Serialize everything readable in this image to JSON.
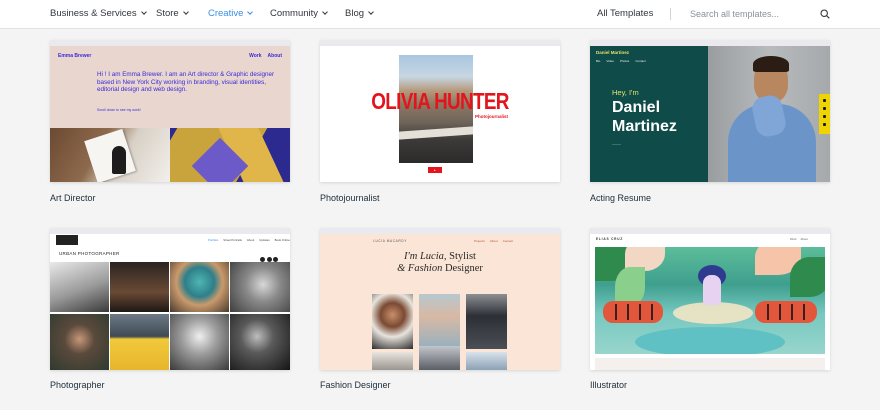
{
  "nav": {
    "items": [
      {
        "label": "Business & Services",
        "active": false
      },
      {
        "label": "Store",
        "active": false
      },
      {
        "label": "Creative",
        "active": true
      },
      {
        "label": "Community",
        "active": false
      },
      {
        "label": "Blog",
        "active": false
      }
    ],
    "all_templates": "All Templates",
    "search_placeholder": "Search all templates...",
    "search_icon": "search-icon",
    "colors": {
      "active": "#3b8ee6",
      "text": "#32373c"
    }
  },
  "templates": [
    {
      "title": "Art Director",
      "preview": {
        "name": "Emma Brewer",
        "menu": [
          "Work",
          "About"
        ],
        "intro": "Hi ! I am Emma Brewer. I am an Art director & Graphic designer based in New York City working in branding, visual identities, editorial design and web design.",
        "scroll_text": "Scroll down to see my work!"
      }
    },
    {
      "title": "Photojournalist",
      "preview": {
        "headline": "OLIVIA HUNTER",
        "subtitle": "Photojournalist"
      }
    },
    {
      "title": "Acting Resume",
      "preview": {
        "logo": "Daniel Martinez",
        "menu": [
          "Bio",
          "Video",
          "Photos",
          "Contact"
        ],
        "greeting": "Hey, I'm",
        "first_name": "Daniel",
        "last_name": "Martinez"
      }
    },
    {
      "title": "Photographer",
      "preview": {
        "heading": "URBAN PHOTOGRAPHER",
        "menu": [
          "Portfolio",
          "Street Portraits",
          "About",
          "Updates",
          "Book Online"
        ]
      }
    },
    {
      "title": "Fashion Designer",
      "preview": {
        "logo": "LUCIA MACARDY",
        "menu": [
          "Projects",
          "About",
          "Contact"
        ],
        "headline_italic": "I'm Lucia,",
        "headline_rest": "Stylist",
        "headline_line2_italic": "& Fashion",
        "headline_line2_rest": "Designer"
      }
    },
    {
      "title": "Illustrator",
      "preview": {
        "logo": "ELIAS CRUZ",
        "menu": [
          "Work",
          "About"
        ]
      }
    }
  ]
}
